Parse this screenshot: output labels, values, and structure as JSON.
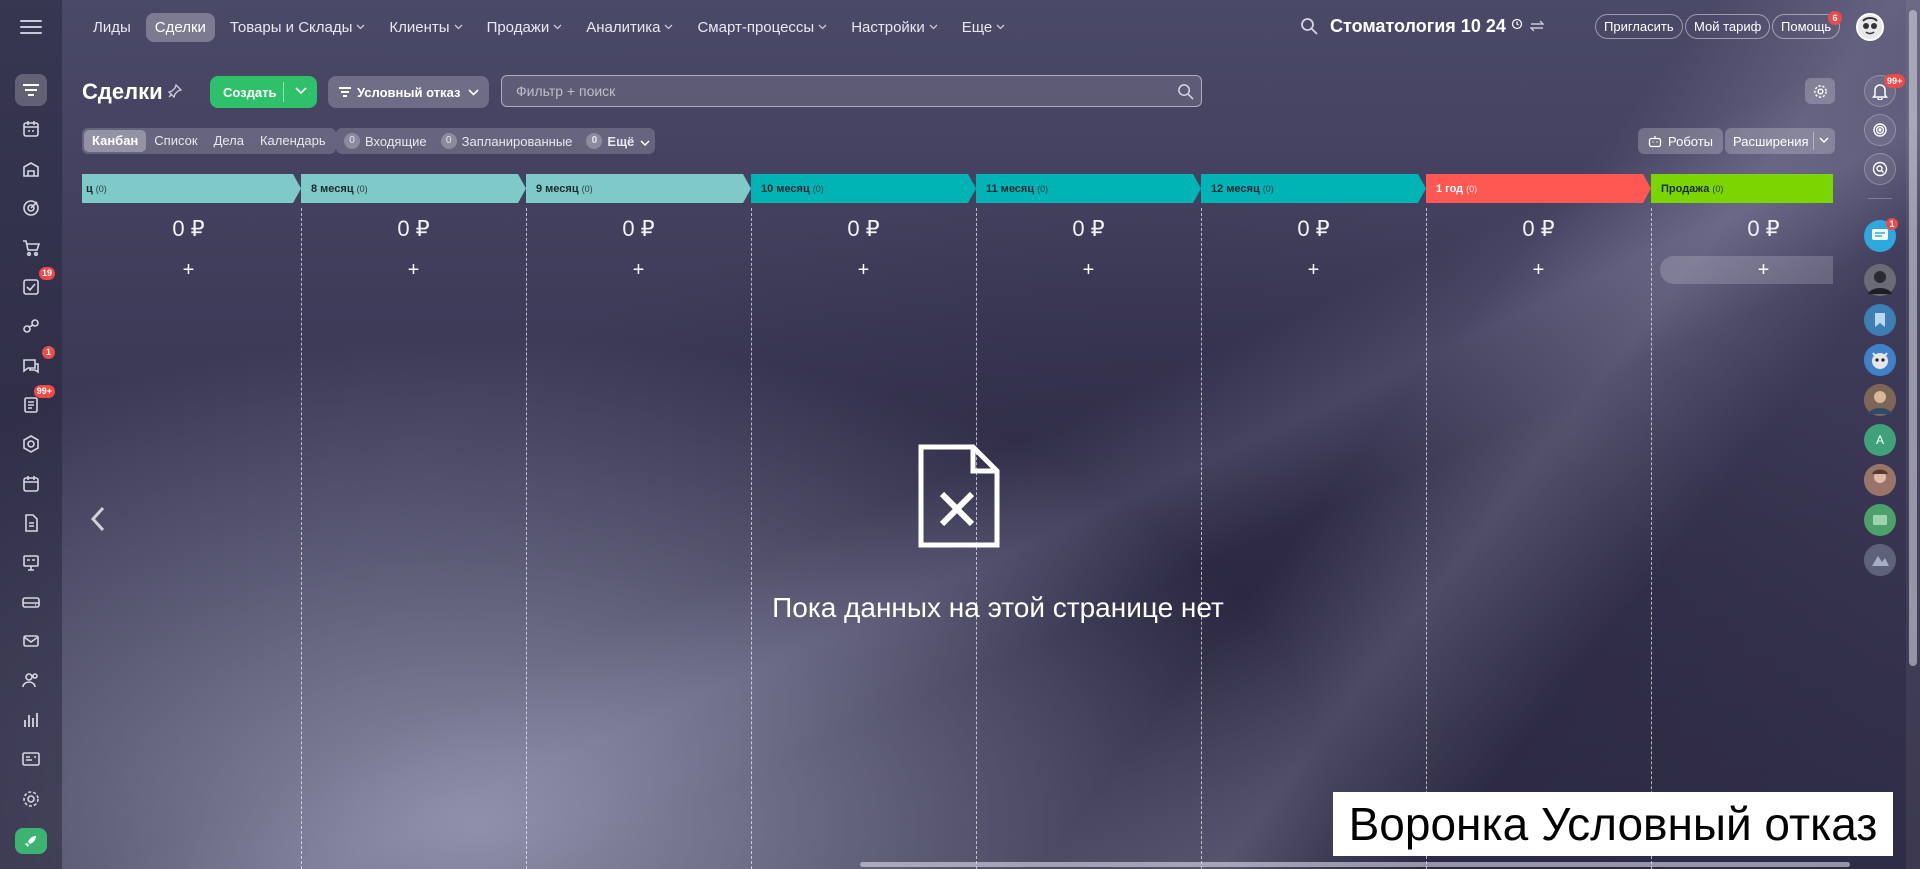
{
  "nav": {
    "items": [
      {
        "label": "Лиды",
        "caret": false,
        "active": false
      },
      {
        "label": "Сделки",
        "caret": false,
        "active": true
      },
      {
        "label": "Товары и Склады",
        "caret": true,
        "active": false
      },
      {
        "label": "Клиенты",
        "caret": true,
        "active": false
      },
      {
        "label": "Продажи",
        "caret": true,
        "active": false
      },
      {
        "label": "Аналитика",
        "caret": true,
        "active": false
      },
      {
        "label": "Смарт-процессы",
        "caret": true,
        "active": false
      },
      {
        "label": "Настройки",
        "caret": true,
        "active": false
      },
      {
        "label": "Еще",
        "caret": true,
        "active": false
      }
    ],
    "company": "Стоматология 10 24",
    "invite": "Пригласить",
    "tariff": "Мой тариф",
    "help": "Помощь",
    "help_badge": "6"
  },
  "left_badges": {
    "tasks": "19",
    "chat": "1",
    "feed": "99+"
  },
  "page": {
    "title": "Сделки",
    "create_label": "Создать",
    "funnel_label": "Условный отказ",
    "search_placeholder": "Фильтр + поиск"
  },
  "views": [
    "Канбан",
    "Список",
    "Дела",
    "Календарь"
  ],
  "counters": [
    {
      "num": "0",
      "label": "Входящие"
    },
    {
      "num": "0",
      "label": "Запланированные"
    },
    {
      "num": "0",
      "label": "Ещё"
    }
  ],
  "robots_label": "Роботы",
  "extensions_label": "Расширения",
  "notify_badge": "99+",
  "chat_badge": "1",
  "right_letter": "А",
  "columns": [
    {
      "name": "ц",
      "count": "(0)",
      "sum": "0 ₽",
      "color": "#7dcac9"
    },
    {
      "name": "8 месяц",
      "count": "(0)",
      "sum": "0 ₽",
      "color": "#7dcac9"
    },
    {
      "name": "9 месяц",
      "count": "(0)",
      "sum": "0 ₽",
      "color": "#7dcac9"
    },
    {
      "name": "10 месяц",
      "count": "(0)",
      "sum": "0 ₽",
      "color": "#00b4b5"
    },
    {
      "name": "11 месяц",
      "count": "(0)",
      "sum": "0 ₽",
      "color": "#00b4b5"
    },
    {
      "name": "12 месяц",
      "count": "(0)",
      "sum": "0 ₽",
      "color": "#00b4b5"
    },
    {
      "name": "1 год",
      "count": "(0)",
      "sum": "0 ₽",
      "color": "#ff5752"
    },
    {
      "name": "Продажа",
      "count": "(0)",
      "sum": "0 ₽",
      "color": "#7bd500"
    }
  ],
  "add_symbol": "+",
  "empty_message": "Пока данных на этой странице нет",
  "caption": "Воронка Условный отказ"
}
